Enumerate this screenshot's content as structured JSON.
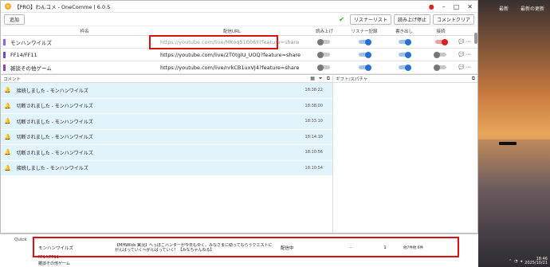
{
  "window": {
    "title": "【PRO】わんコメ - OneComme | 6.0.5"
  },
  "toolbar": {
    "add_label": "追加",
    "buttons": [
      "リスナーリスト",
      "読み上げ停止",
      "コメントクリア"
    ]
  },
  "table": {
    "headers": [
      "枠名",
      "配信URL",
      "読み上げ",
      "リスナー記録",
      "書き出し",
      "接続"
    ],
    "rows": [
      {
        "name": "モンハンワイルズ",
        "url": "https://youtube.com/live/MKoq51E06ll?feature=share",
        "color": "#9b5de5",
        "read": false,
        "listener": true,
        "export": true,
        "connected": true
      },
      {
        "name": "FF14/FF11",
        "url": "https://youtube.com/live/2T0tgIU_UOQ?feature=share",
        "color": "#6a4bc4",
        "read": false,
        "listener": true,
        "export": true,
        "connected": false
      },
      {
        "name": "雑談その他ゲーム",
        "url": "https://youtube.com/live/nrkCB1uxVJ4?feature=share",
        "color": "#8e44ad",
        "read": false,
        "listener": true,
        "export": true,
        "connected": false
      }
    ]
  },
  "comments_pane": {
    "label": "コメント",
    "items": [
      {
        "text": "接続しました - モンハンワイルズ",
        "time": "18:38:22"
      },
      {
        "text": "切断されました - モンハンワイルズ",
        "time": "18:38:00"
      },
      {
        "text": "切断されました - モンハンワイルズ",
        "time": "18:33:10"
      },
      {
        "text": "切断されました - モンハンワイルズ",
        "time": "18:14:10"
      },
      {
        "text": "切断されました - モンハンワイルズ",
        "time": "18:10:56"
      },
      {
        "text": "接続しました - モンハンワイルズ",
        "time": "18:10:54"
      }
    ]
  },
  "gift_pane": {
    "label": "ギフト/スパチャ"
  },
  "bottom": {
    "left_label": "Quick",
    "row_name": "モンハンワイルズ",
    "row_title": "【MHWilds 実況】ヘっぽこハンターが今日もゆく。みなさまに助ってもらうクエストにがんばっていく～がんばっていく！【みなちゃんねる】",
    "row_status": "配信中",
    "row_dash": "-",
    "row_count": "1",
    "row_extra": "他7件他 6件",
    "next_rows": [
      "FF14/FF11",
      "雑談その他ゲーム"
    ]
  },
  "desktop": {
    "icons": [
      "最新",
      "最新の更新"
    ]
  },
  "clock": {
    "time": "18:46",
    "date": "2025/10/21"
  }
}
